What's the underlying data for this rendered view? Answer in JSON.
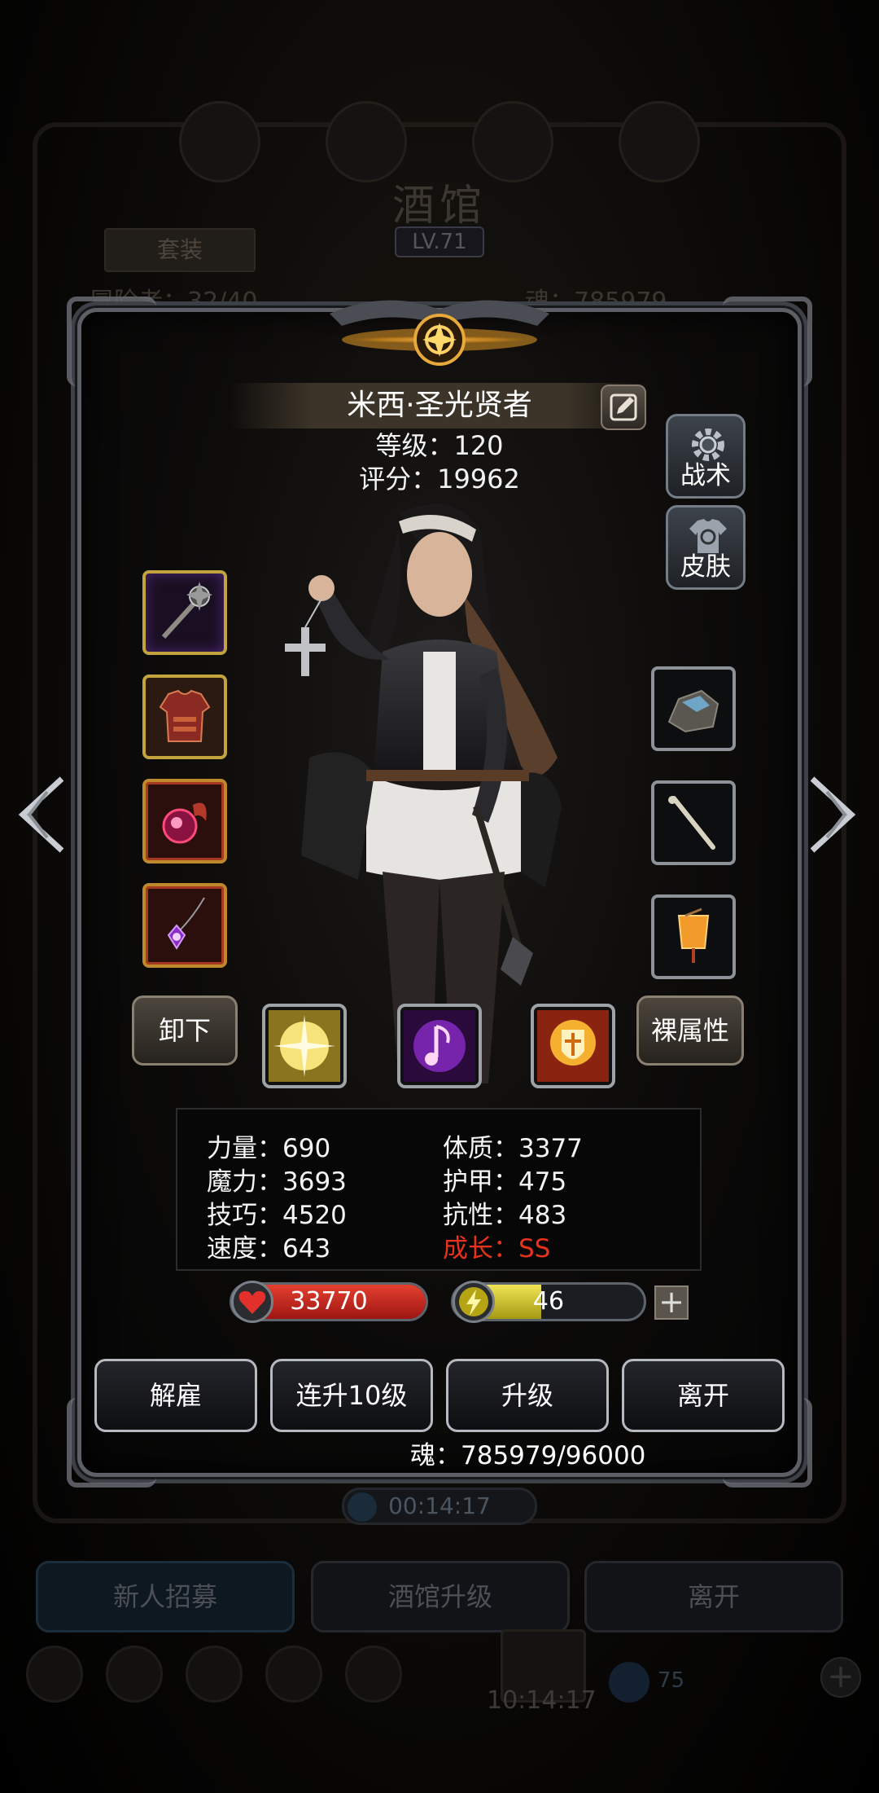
{
  "background": {
    "title": "酒馆",
    "level": "LV.71",
    "suit_label": "套装",
    "header_left": "冒险者：32/40",
    "header_right": "魂：785979",
    "timer": "00:14:17",
    "buttons": [
      "新人招募",
      "酒馆升级",
      "离开"
    ],
    "chest_timer": "10:14:17",
    "gem_count": "75"
  },
  "hero": {
    "name": "米西·圣光贤者",
    "level_text": "等级：120",
    "score_text": "评分：19962"
  },
  "side_tabs": {
    "tactics": "战术",
    "skin": "皮肤"
  },
  "equipment": {
    "left": [
      "mace-icon",
      "armor-icon",
      "orb-icon",
      "amulet-icon"
    ],
    "right": [
      "ore-icon",
      "bone-icon",
      "lantern-icon"
    ]
  },
  "buttons": {
    "unequip": "卸下",
    "naked_attributes": "裸属性"
  },
  "skills": [
    "holy-burst-icon",
    "music-note-icon",
    "holy-shield-icon"
  ],
  "stats": {
    "strength": "力量：690",
    "magic": "魔力：3693",
    "skill": "技巧：4520",
    "speed": "速度：643",
    "constitution": "体质：3377",
    "armor": "护甲：475",
    "resistance": "抗性：483",
    "growth": "成长：SS"
  },
  "bars": {
    "hp": "33770",
    "hp_fill": 1.0,
    "energy": "46",
    "energy_fill": 0.46,
    "plus_label": "+"
  },
  "actions": {
    "dismiss": "解雇",
    "upgrade10": "连升10级",
    "upgrade": "升级",
    "leave": "离开"
  },
  "soul_text": "魂：785979/96000",
  "colors": {
    "growth": "#e8321c",
    "hp": "#d9301f",
    "energy": "#e6da3c"
  }
}
